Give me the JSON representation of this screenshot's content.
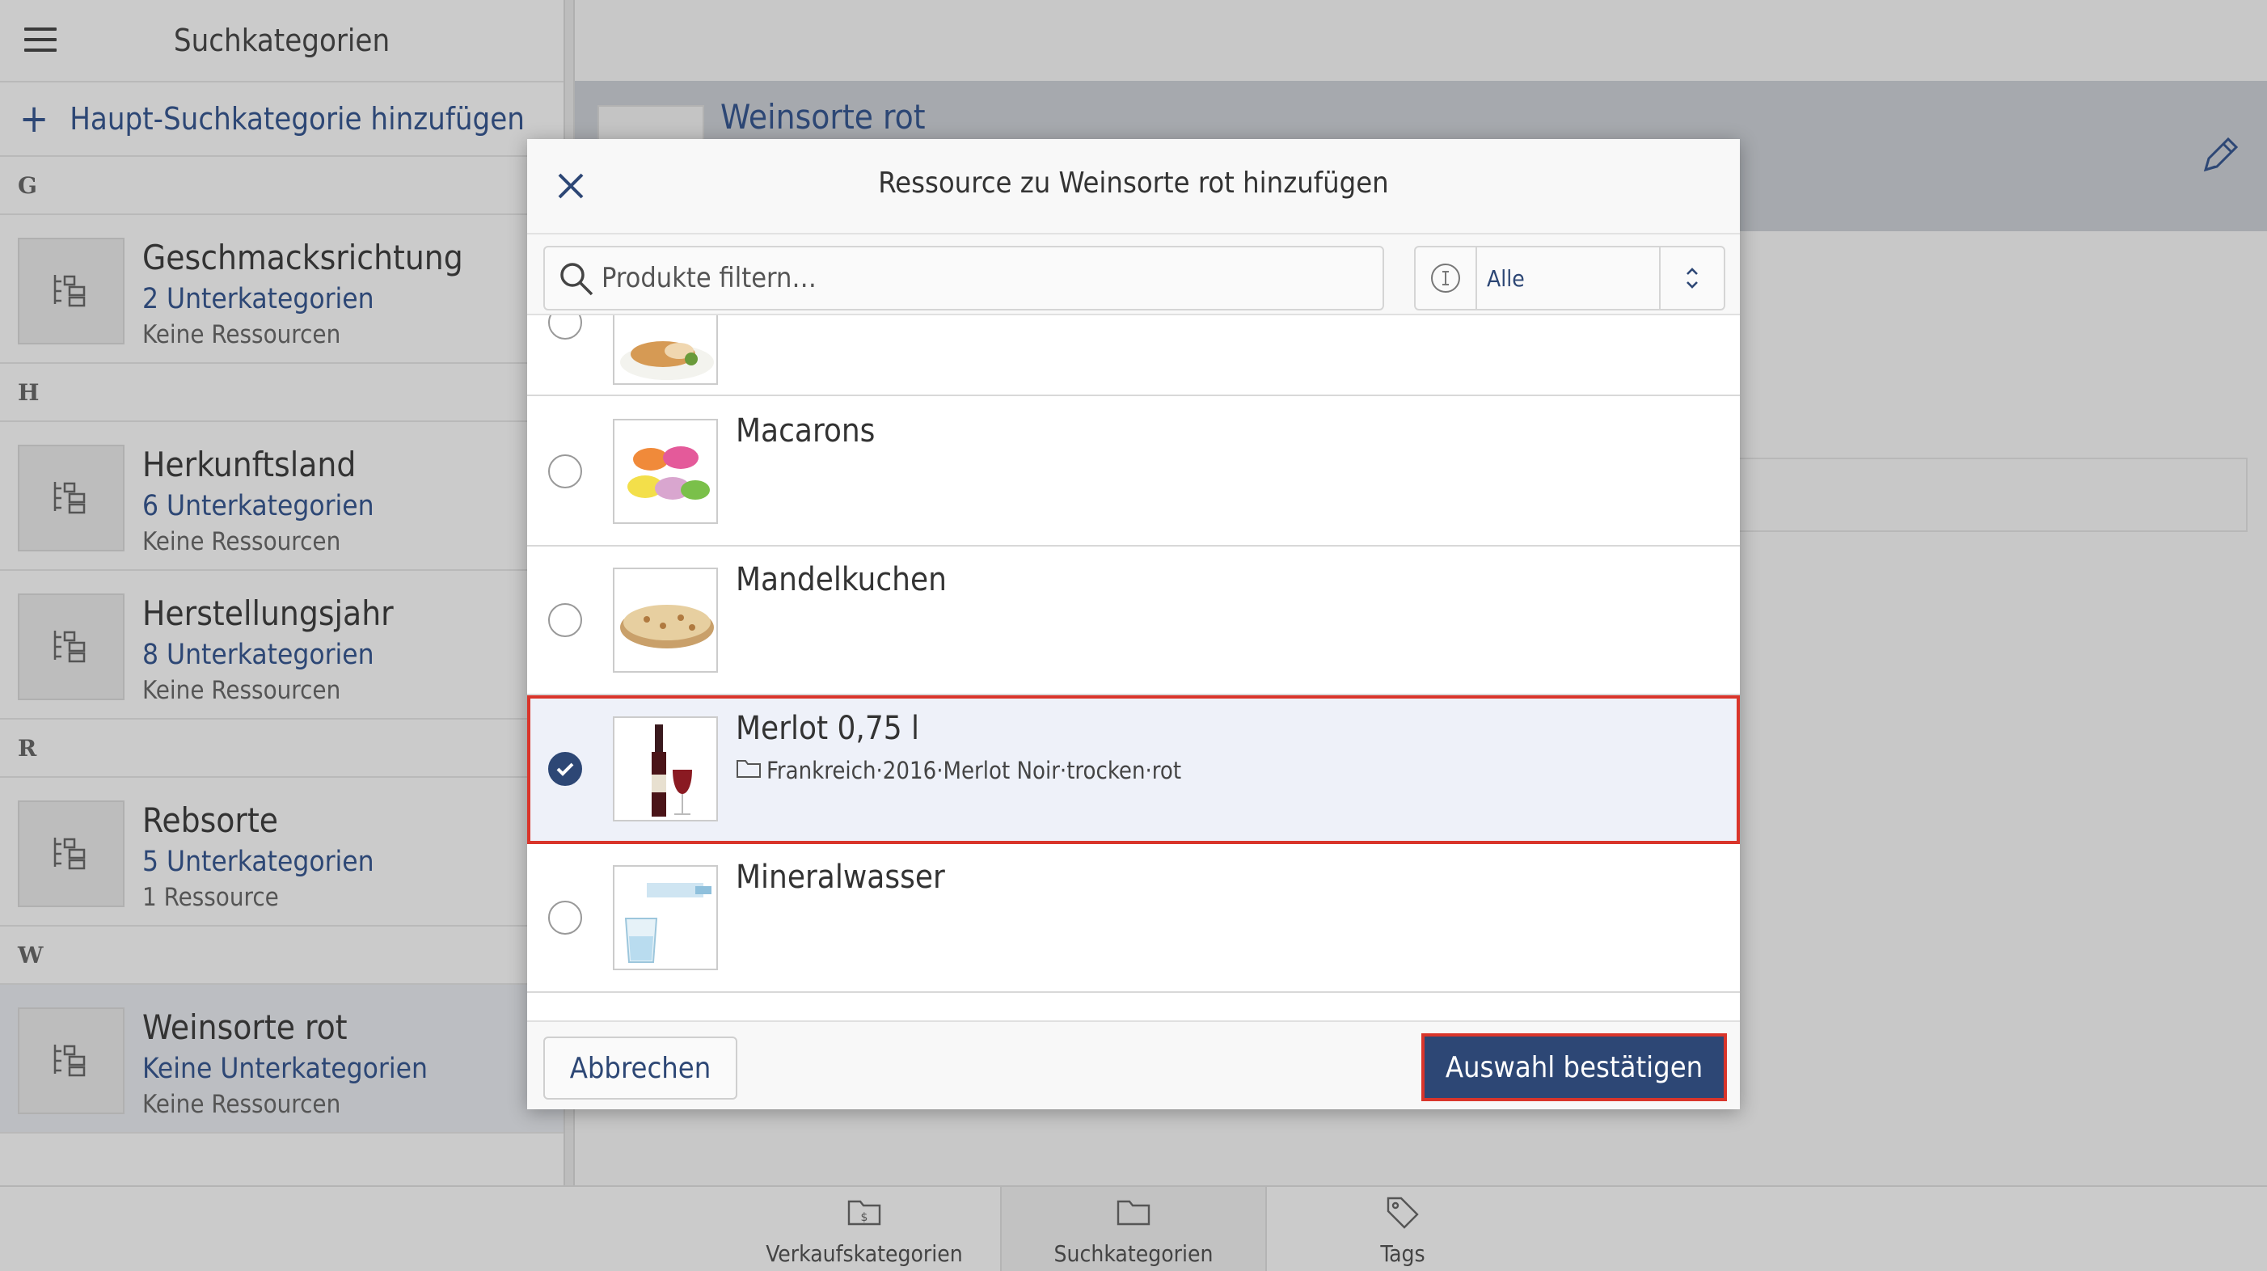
{
  "sidebar": {
    "title": "Suchkategorien",
    "add_main_label": "Haupt-Suchkategorie hinzufügen",
    "groups": [
      {
        "letter": "G",
        "items": [
          {
            "name": "Geschmacksrichtung",
            "sub": "2 Unterkategorien",
            "res": "Keine Ressourcen"
          }
        ]
      },
      {
        "letter": "H",
        "items": [
          {
            "name": "Herkunftsland",
            "sub": "6 Unterkategorien",
            "res": "Keine Ressourcen"
          },
          {
            "name": "Herstellungsjahr",
            "sub": "8 Unterkategorien",
            "res": "Keine Ressourcen"
          }
        ]
      },
      {
        "letter": "R",
        "items": [
          {
            "name": "Rebsorte",
            "sub": "5 Unterkategorien",
            "res": "1 Ressource"
          }
        ]
      },
      {
        "letter": "W",
        "items": [
          {
            "name": "Weinsorte rot",
            "sub": "Keine Unterkategorien",
            "res": "Keine Ressourcen"
          }
        ]
      }
    ]
  },
  "detail": {
    "title": "Weinsorte rot"
  },
  "modal": {
    "title": "Ressource zu Weinsorte rot hinzufügen",
    "search_placeholder": "Produkte filtern…",
    "select_value": "Alle",
    "items": [
      {
        "name": "",
        "checked": false,
        "image": "dish"
      },
      {
        "name": "Macarons",
        "checked": false,
        "image": "macarons"
      },
      {
        "name": "Mandelkuchen",
        "checked": false,
        "image": "cake"
      },
      {
        "name": "Merlot 0,75 l",
        "checked": true,
        "image": "wine",
        "tags": "Frankreich·2016·Merlot Noir·trocken·rot"
      },
      {
        "name": "Mineralwasser",
        "checked": false,
        "image": "water"
      }
    ],
    "cancel_label": "Abbrechen",
    "confirm_label": "Auswahl bestätigen"
  },
  "bottom_nav": [
    {
      "label": "Verkaufskategorien",
      "icon": "folder-dollar-icon"
    },
    {
      "label": "Suchkategorien",
      "icon": "folder-icon",
      "active": true
    },
    {
      "label": "Tags",
      "icon": "tag-icon"
    }
  ],
  "colors": {
    "accent": "#2d4775",
    "highlight": "#d9352b",
    "selected_row": "#eef1f9"
  }
}
